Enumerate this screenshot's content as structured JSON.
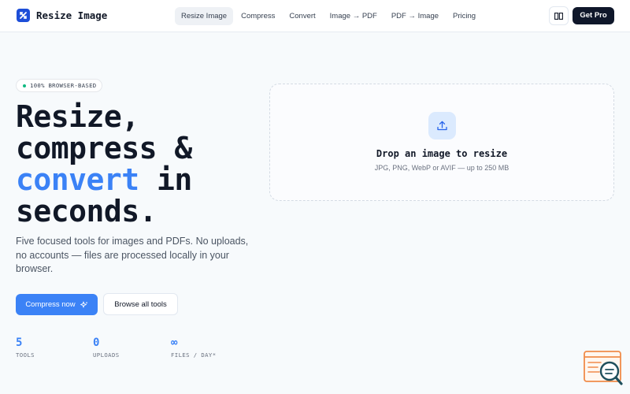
{
  "header": {
    "logo_text": "Resize Image",
    "nav": [
      "Resize Image",
      "Compress",
      "Convert",
      "Image → PDF",
      "PDF → Image",
      "Pricing"
    ],
    "active_nav": "Resize Image",
    "cta_label": "Get Pro"
  },
  "hero": {
    "badge": "100% BROWSER-BASED",
    "headline_line1": "Resize,",
    "headline_line2": "compress &",
    "headline_accent": "convert",
    "headline_line3_rest": " in",
    "headline_line4": "seconds.",
    "subtitle": "Five focused tools for images and PDFs. No uploads, no accounts — files are processed locally in your browser.",
    "primary_button": "Compress now",
    "secondary_button": "Browse all tools",
    "stats": [
      {
        "value": "5",
        "label": "TOOLS"
      },
      {
        "value": "0",
        "label": "UPLOADS"
      },
      {
        "value": "∞",
        "label": "FILES / DAY*"
      }
    ]
  },
  "dropzone": {
    "title": "Drop an image to resize",
    "subtitle": "JPG, PNG, WebP or AVIF — up to 250 MB"
  },
  "colors": {
    "accent": "#3b82f6",
    "dark": "#0f172a",
    "badge_dot": "#10b981",
    "widget_orange": "#f08c4a",
    "widget_teal": "#1f4f5c"
  }
}
